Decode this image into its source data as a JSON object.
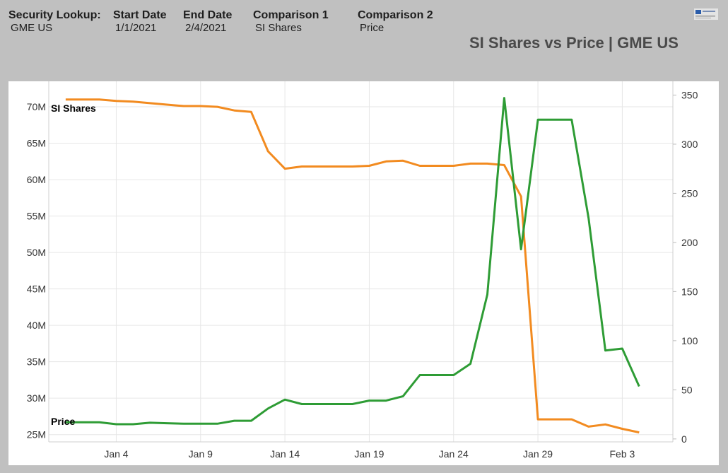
{
  "header": {
    "security_label": "Security Lookup:",
    "security_value": "GME US",
    "start_label": "Start Date",
    "start_value": "1/1/2021",
    "end_label": "End Date",
    "end_value": "2/4/2021",
    "comp1_label": "Comparison 1",
    "comp1_value": "SI Shares",
    "comp2_label": "Comparison 2",
    "comp2_value": "Price"
  },
  "logo_icon": "s3-partners-logo",
  "chart_data": {
    "type": "line",
    "title": "SI Shares vs Price | GME US",
    "x_ticks": [
      "Jan 4",
      "Jan 9",
      "Jan 14",
      "Jan 19",
      "Jan 24",
      "Jan 29",
      "Feb 3"
    ],
    "x_tick_dates": [
      "2021-01-04",
      "2021-01-09",
      "2021-01-14",
      "2021-01-19",
      "2021-01-24",
      "2021-01-29",
      "2021-02-03"
    ],
    "x_range": [
      "2020-12-31",
      "2021-02-06"
    ],
    "y_left": {
      "ticks": [
        "25M",
        "30M",
        "35M",
        "40M",
        "45M",
        "50M",
        "55M",
        "60M",
        "65M",
        "70M"
      ],
      "ylim": [
        24,
        73.5
      ],
      "unit": "shares"
    },
    "y_right": {
      "ticks": [
        "0",
        "50",
        "100",
        "150",
        "200",
        "250",
        "300",
        "350"
      ],
      "ylim": [
        -3,
        364
      ]
    },
    "grid": true,
    "series": [
      {
        "name": "SI Shares",
        "axis": "left",
        "color": "#f28b20",
        "points": [
          [
            "2021-01-01",
            71.0
          ],
          [
            "2021-01-03",
            71.0
          ],
          [
            "2021-01-04",
            70.8
          ],
          [
            "2021-01-05",
            70.7
          ],
          [
            "2021-01-06",
            70.5
          ],
          [
            "2021-01-07",
            70.3
          ],
          [
            "2021-01-08",
            70.1
          ],
          [
            "2021-01-09",
            70.1
          ],
          [
            "2021-01-10",
            70.0
          ],
          [
            "2021-01-11",
            69.5
          ],
          [
            "2021-01-12",
            69.3
          ],
          [
            "2021-01-13",
            63.9
          ],
          [
            "2021-01-14",
            61.5
          ],
          [
            "2021-01-15",
            61.8
          ],
          [
            "2021-01-16",
            61.8
          ],
          [
            "2021-01-17",
            61.8
          ],
          [
            "2021-01-18",
            61.8
          ],
          [
            "2021-01-19",
            61.9
          ],
          [
            "2021-01-20",
            62.5
          ],
          [
            "2021-01-21",
            62.6
          ],
          [
            "2021-01-22",
            61.9
          ],
          [
            "2021-01-23",
            61.9
          ],
          [
            "2021-01-24",
            61.9
          ],
          [
            "2021-01-25",
            62.2
          ],
          [
            "2021-01-26",
            62.2
          ],
          [
            "2021-01-27",
            62.0
          ],
          [
            "2021-01-28",
            57.7
          ],
          [
            "2021-01-29",
            27.1
          ],
          [
            "2021-01-30",
            27.1
          ],
          [
            "2021-01-31",
            27.1
          ],
          [
            "2021-02-01",
            26.1
          ],
          [
            "2021-02-02",
            26.4
          ],
          [
            "2021-02-03",
            25.8
          ],
          [
            "2021-02-04",
            25.3
          ]
        ]
      },
      {
        "name": "Price",
        "axis": "right",
        "color": "#2e9c35",
        "points": [
          [
            "2021-01-01",
            17
          ],
          [
            "2021-01-03",
            17
          ],
          [
            "2021-01-04",
            15
          ],
          [
            "2021-01-05",
            15
          ],
          [
            "2021-01-06",
            16.5
          ],
          [
            "2021-01-07",
            16
          ],
          [
            "2021-01-08",
            15.5
          ],
          [
            "2021-01-09",
            15.5
          ],
          [
            "2021-01-10",
            15.5
          ],
          [
            "2021-01-11",
            18.5
          ],
          [
            "2021-01-12",
            18.5
          ],
          [
            "2021-01-13",
            31
          ],
          [
            "2021-01-14",
            40
          ],
          [
            "2021-01-15",
            35.5
          ],
          [
            "2021-01-16",
            35.5
          ],
          [
            "2021-01-17",
            35.5
          ],
          [
            "2021-01-18",
            35.5
          ],
          [
            "2021-01-19",
            39
          ],
          [
            "2021-01-20",
            39
          ],
          [
            "2021-01-21",
            43.5
          ],
          [
            "2021-01-22",
            65
          ],
          [
            "2021-01-23",
            65
          ],
          [
            "2021-01-24",
            65
          ],
          [
            "2021-01-25",
            76.5
          ],
          [
            "2021-01-26",
            147
          ],
          [
            "2021-01-27",
            347
          ],
          [
            "2021-01-28",
            193
          ],
          [
            "2021-01-29",
            325
          ],
          [
            "2021-01-30",
            325
          ],
          [
            "2021-01-31",
            325
          ],
          [
            "2021-02-01",
            225
          ],
          [
            "2021-02-02",
            90
          ],
          [
            "2021-02-03",
            92
          ],
          [
            "2021-02-04",
            53.5
          ]
        ]
      }
    ],
    "annotations": [
      {
        "text": "SI Shares",
        "series": "SI Shares"
      },
      {
        "text": "Price",
        "series": "Price"
      }
    ]
  }
}
